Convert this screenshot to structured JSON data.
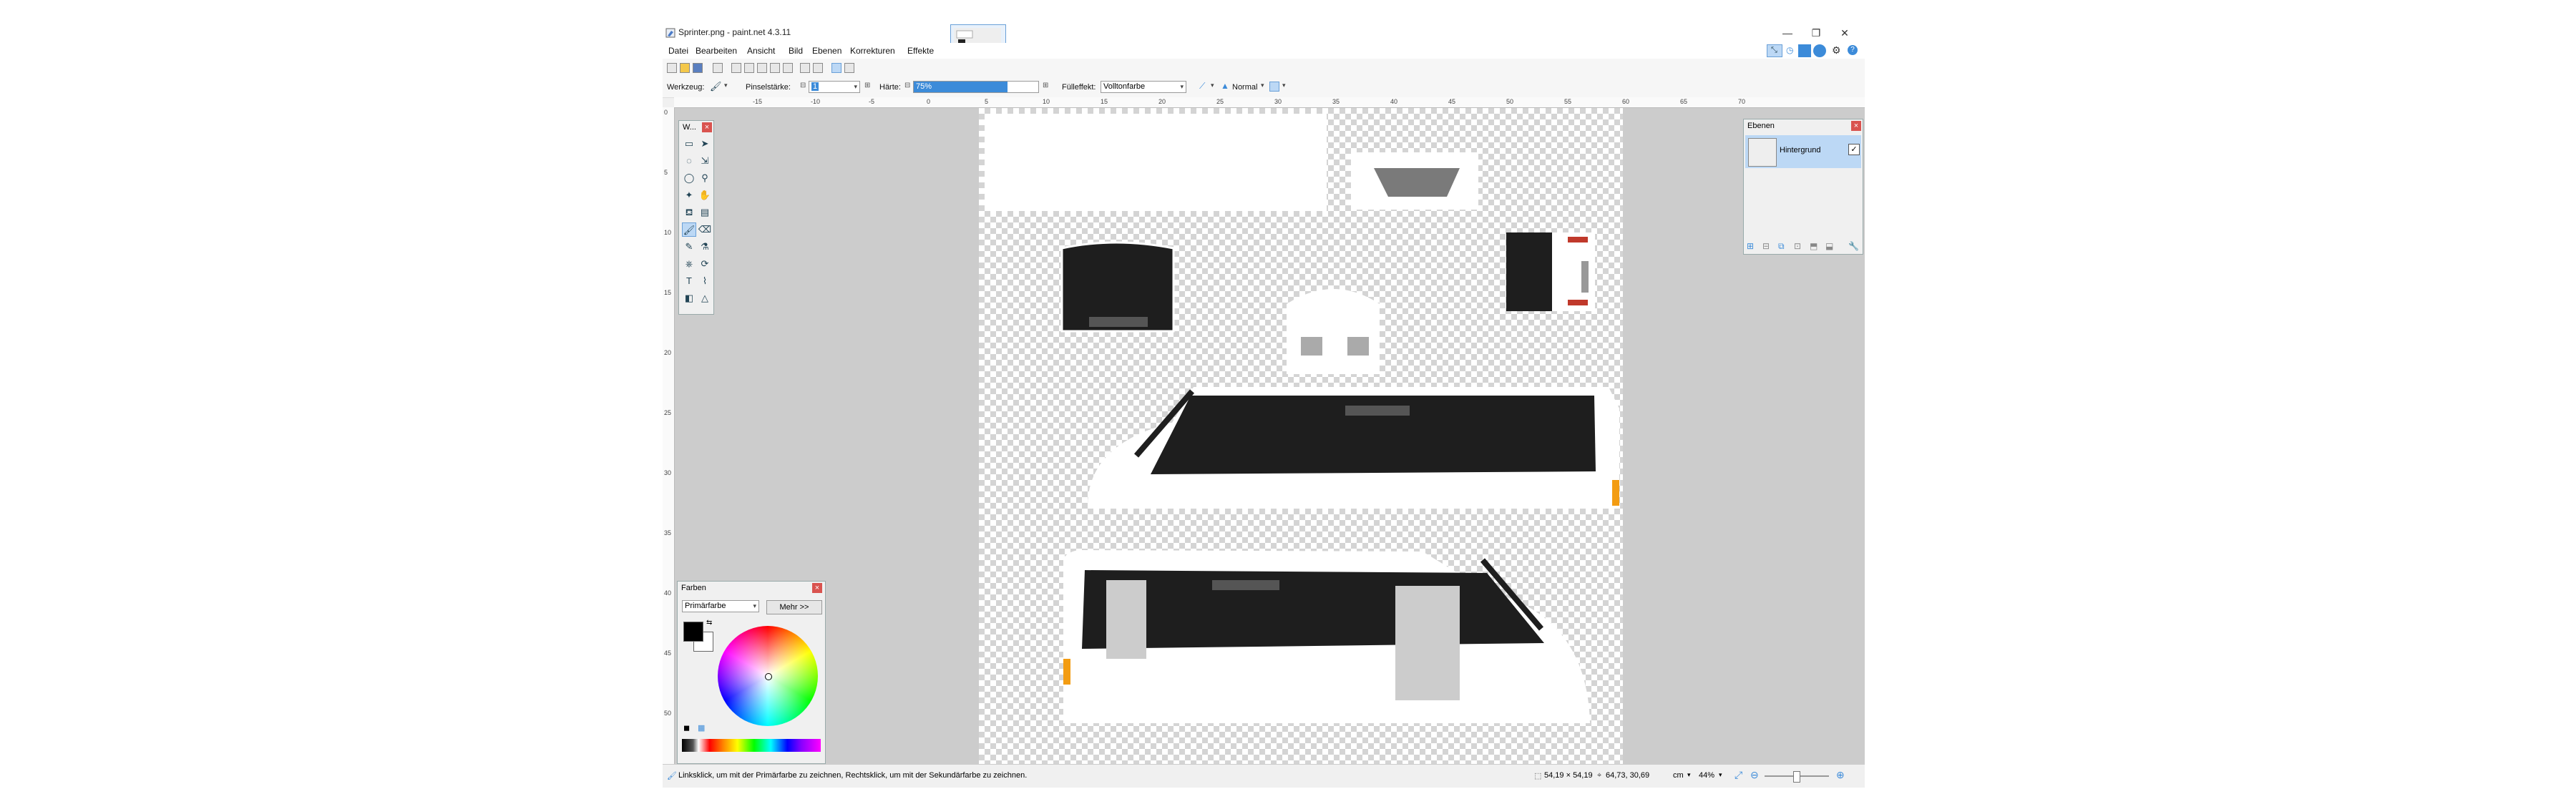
{
  "window": {
    "title": "Sprinter.png - paint.net 4.3.11",
    "minimize_glyph": "—",
    "restore_glyph": "❐",
    "close_glyph": "✕"
  },
  "menu": [
    "Datei",
    "Bearbeiten",
    "Ansicht",
    "Bild",
    "Ebenen",
    "Korrekturen",
    "Effekte"
  ],
  "toolbar": {
    "tool_label": "Werkzeug:",
    "brush_size_label": "Pinselstärke:",
    "brush_size_value": "1",
    "hardness_label": "Härte:",
    "hardness_value": "75%",
    "hardness_fraction": 0.75,
    "fill_label": "Fülleffekt:",
    "fill_value": "Vollton­farbe",
    "blend_value": "Normal"
  },
  "tools_panel": {
    "title": "W..."
  },
  "layers_panel": {
    "title": "Ebenen",
    "layers": [
      {
        "name": "Hintergrund",
        "visible": true
      }
    ]
  },
  "colors_panel": {
    "title": "Farben",
    "mode_value": "Primärfarbe",
    "more_button": "Mehr >>",
    "primary_color": "#000000",
    "secondary_color": "#ffffff"
  },
  "status": {
    "hint": "Linksklick, um mit der Primärfarbe zu zeichnen, Rechtsklick, um mit der Sekundärfarbe zu zeichnen.",
    "image_size": "54,19 × 54,19",
    "cursor_position": "64,73, 30,69",
    "unit": "cm",
    "zoom": "44%"
  },
  "ruler_top_ticks": [
    "-15",
    "-10",
    "-5",
    "0",
    "5",
    "10",
    "15",
    "20",
    "25",
    "30",
    "35",
    "40",
    "45",
    "50",
    "55",
    "60",
    "65",
    "70"
  ],
  "ruler_left_ticks": [
    "0",
    "5",
    "10",
    "15",
    "20",
    "25",
    "30",
    "35",
    "40",
    "45",
    "50"
  ],
  "colors": {
    "accent": "#3c8bd9",
    "selection": "#bcd8f5",
    "van_body": "#ffffff",
    "window_dark": "#1e1e1e",
    "indicator": "#f39c12",
    "tail_red": "#c0392b"
  }
}
